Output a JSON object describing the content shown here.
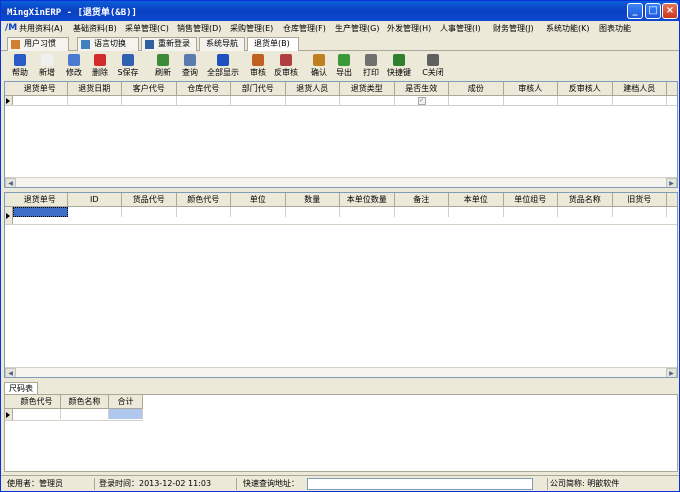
{
  "window": {
    "title": "MingXinERP - [退货单(&B)]",
    "controls": [
      "_",
      "□",
      "×"
    ]
  },
  "menu": {
    "items": [
      "共用资料(A)",
      "基础资料(B)",
      "采单管理(C)",
      "销售管理(D)",
      "采购管理(E)",
      "仓库管理(F)",
      "生产管理(G)",
      "外发管理(H)",
      "人事管理(I)",
      "财务管理(J)",
      "系统功能(K)",
      "图表功能"
    ]
  },
  "top_tabs": [
    "用户习惯",
    "语言切换",
    "重新登录",
    "系统导航",
    "退货单(B)"
  ],
  "toolbar": {
    "buttons": [
      "帮助",
      "新增",
      "修改",
      "删除",
      "S保存",
      "刷新",
      "查询",
      "全部显示",
      "审核",
      "反审核",
      "确认",
      "导出",
      "打印",
      "快捷键",
      "C关闭"
    ],
    "icons": [
      "help-icon",
      "new-icon",
      "edit-icon",
      "delete-icon",
      "save-icon",
      "refresh-icon",
      "query-icon",
      "show-all-icon",
      "approve-icon",
      "unapprove-icon",
      "confirm-icon",
      "export-icon",
      "print-icon",
      "shortcut-icon",
      "close-icon"
    ],
    "colors": [
      "#2a5bc7",
      "#f0f0f0",
      "#4a7bd0",
      "#d22b2b",
      "#3060b0",
      "#3a8a3a",
      "#5a7ab0",
      "#2050c0",
      "#c06020",
      "#b04040",
      "#c08020",
      "#3a9a3a",
      "#707070",
      "#308030",
      "#606060"
    ]
  },
  "master_grid": {
    "columns": [
      "退货单号",
      "退货日期",
      "客户代号",
      "仓库代号",
      "部门代号",
      "退货人员",
      "退货类型",
      "是否生效",
      "成份",
      "审核人",
      "反审核人",
      "建档人员"
    ],
    "row": {
      "is_effective_check": "✓"
    }
  },
  "detail_grid": {
    "columns": [
      "退货单号",
      "ID",
      "货品代号",
      "颜色代号",
      "单位",
      "数量",
      "本单位数量",
      "备注",
      "本单位",
      "单位组号",
      "货品名称",
      "旧货号"
    ]
  },
  "size_panel": {
    "tab": "尺码表",
    "columns": [
      "颜色代号",
      "颜色名称",
      "合计"
    ]
  },
  "status_bar": {
    "user": "使用者：管理员",
    "login_time": "登录时间：2013-12-02 11:03",
    "quick_query": "快速查询地址：",
    "company": "公司简称: 明歆软件"
  },
  "colors": {
    "titlebar": "#0b49d0",
    "selected_cell": "#b0c8f0",
    "selected_cell_dark": "#3d6fc6"
  }
}
